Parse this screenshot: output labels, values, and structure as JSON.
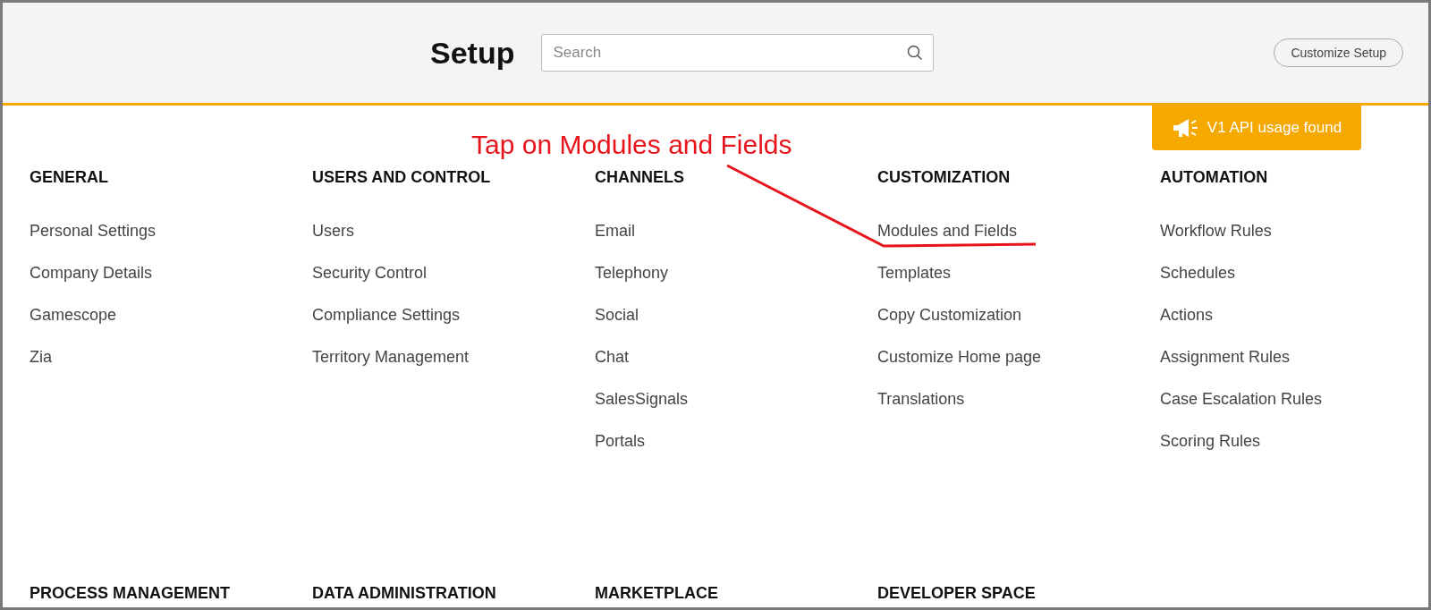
{
  "header": {
    "title": "Setup",
    "search": {
      "placeholder": "Search"
    },
    "customize_button": "Customize Setup"
  },
  "notice_badge": "V1 API usage found",
  "annotation": "Tap on Modules and Fields",
  "sections": [
    {
      "heading": "GENERAL",
      "items": [
        "Personal Settings",
        "Company Details",
        "Gamescope",
        "Zia"
      ]
    },
    {
      "heading": "USERS AND CONTROL",
      "items": [
        "Users",
        "Security Control",
        "Compliance Settings",
        "Territory Management"
      ]
    },
    {
      "heading": "CHANNELS",
      "items": [
        "Email",
        "Telephony",
        "Social",
        "Chat",
        "SalesSignals",
        "Portals"
      ]
    },
    {
      "heading": "CUSTOMIZATION",
      "items": [
        "Modules and Fields",
        "Templates",
        "Copy Customization",
        "Customize Home page",
        "Translations"
      ]
    },
    {
      "heading": "AUTOMATION",
      "items": [
        "Workflow Rules",
        "Schedules",
        "Actions",
        "Assignment Rules",
        "Case Escalation Rules",
        "Scoring Rules"
      ]
    }
  ],
  "more_sections": [
    "PROCESS MANAGEMENT",
    "DATA ADMINISTRATION",
    "MARKETPLACE",
    "DEVELOPER SPACE"
  ]
}
